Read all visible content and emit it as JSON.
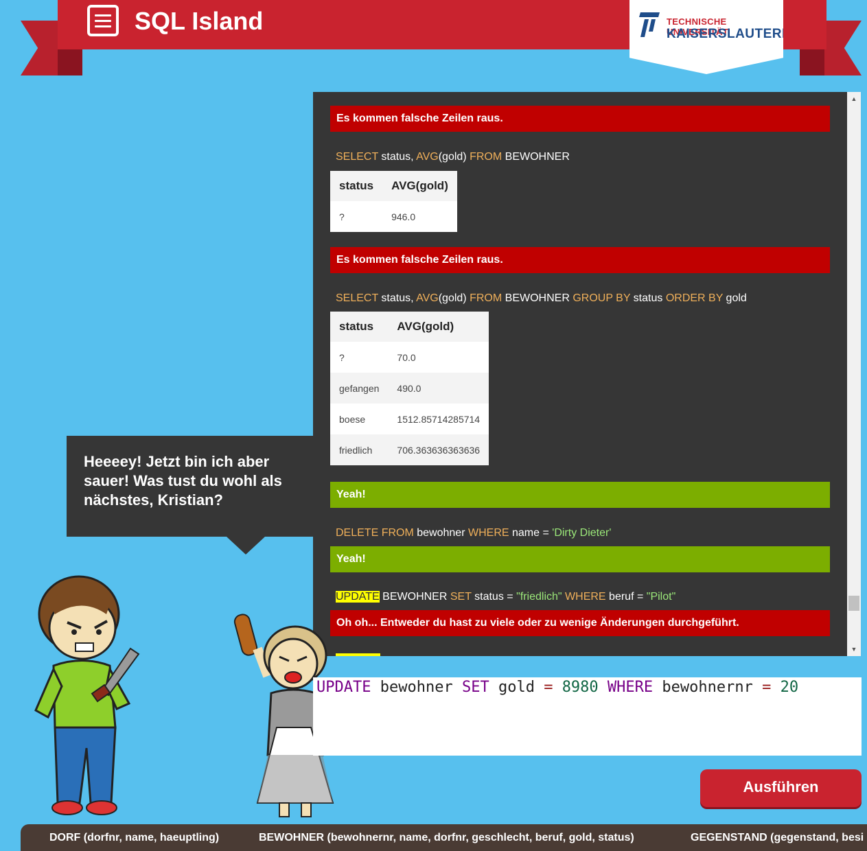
{
  "header": {
    "menu_icon": "menu-icon",
    "title": "SQL Island",
    "university": {
      "line1": "TECHNISCHE UNIVERSITÄT",
      "line2": "KAISERSLAUTERN"
    }
  },
  "log": {
    "msg1": "Es kommen falsche Zeilen raus.",
    "query1": {
      "parts": [
        "SELECT",
        "status,",
        "AVG",
        "(gold)",
        "FROM",
        "BEWOHNER"
      ]
    },
    "table1": {
      "headers": [
        "status",
        "AVG(gold)"
      ],
      "rows": [
        [
          "?",
          "946.0"
        ]
      ]
    },
    "msg2": "Es kommen falsche Zeilen raus.",
    "query2": {
      "parts": [
        "SELECT",
        "status,",
        "AVG",
        "(gold)",
        "FROM",
        "BEWOHNER",
        "GROUP BY",
        "status",
        "ORDER BY",
        "gold"
      ]
    },
    "table2": {
      "headers": [
        "status",
        "AVG(gold)"
      ],
      "rows": [
        [
          "?",
          "70.0"
        ],
        [
          "gefangen",
          "490.0"
        ],
        [
          "boese",
          "1512.85714285714"
        ],
        [
          "friedlich",
          "706.363636363636"
        ]
      ]
    },
    "msg3": "Yeah!",
    "query3": {
      "parts": [
        "DELETE FROM",
        "bewohner",
        "WHERE",
        "name =",
        "'Dirty Dieter'"
      ]
    },
    "msg4": "Yeah!",
    "query4": {
      "parts": [
        "UPDATE",
        "BEWOHNER",
        "SET",
        "status =",
        "\"friedlich\"",
        "WHERE",
        "beruf =",
        "\"Pilot\""
      ]
    },
    "msg5": "Oh oh... Entweder du hast zu viele oder zu wenige Änderungen durchgeführt."
  },
  "bubble": {
    "text": "Heeeey! Jetzt bin ich aber sauer! Was tust du wohl als nächstes, Kristian?"
  },
  "editor": {
    "tokens": [
      "UPDATE",
      "bewohner",
      "SET",
      "gold",
      "=",
      "8980",
      "WHERE",
      "bewohnernr",
      "=",
      "20"
    ]
  },
  "run_button": {
    "label": "Ausführen"
  },
  "schema": {
    "dorf": "DORF (dorfnr, name, haeuptling)",
    "bewohner": "BEWOHNER (bewohnernr, name, dorfnr, geschlecht, beruf, gold, status)",
    "gegenstand": "GEGENSTAND (gegenstand, besi"
  },
  "colors": {
    "background": "#57c0ee",
    "ribbon": "#c9232f",
    "panel": "#363636",
    "error": "#c00000",
    "success": "#7cae00",
    "keyword": "#f0b05a"
  }
}
